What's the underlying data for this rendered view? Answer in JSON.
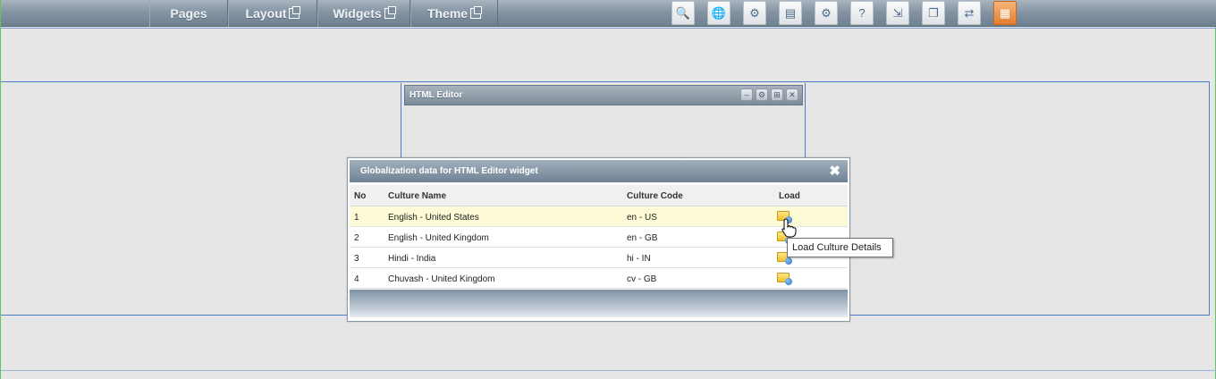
{
  "topbar": {
    "menu": [
      {
        "label": "Pages",
        "external": false
      },
      {
        "label": "Layout",
        "external": true
      },
      {
        "label": "Widgets",
        "external": true
      },
      {
        "label": "Theme",
        "external": true
      }
    ],
    "tools": [
      {
        "icon": "zoom-icon",
        "glyph": "🔍"
      },
      {
        "icon": "globe-icon",
        "glyph": "🌐"
      },
      {
        "icon": "globe-settings-icon",
        "glyph": "⚙"
      },
      {
        "icon": "page-icon",
        "glyph": "▤"
      },
      {
        "icon": "gear-icon",
        "glyph": "⚙"
      },
      {
        "icon": "help-icon",
        "glyph": "?"
      },
      {
        "icon": "export-icon",
        "glyph": "⇲"
      },
      {
        "icon": "windows-icon",
        "glyph": "❐"
      },
      {
        "icon": "flow-icon",
        "glyph": "⇄"
      },
      {
        "icon": "office-icon",
        "glyph": "▦"
      }
    ]
  },
  "widget": {
    "title": "HTML Editor",
    "controls": [
      "–",
      "⚙",
      "⊞",
      "✕"
    ]
  },
  "dialog": {
    "title": "Globalization data for HTML Editor widget",
    "close": "✖",
    "columns": {
      "no": "No",
      "name": "Culture Name",
      "code": "Culture Code",
      "load": "Load"
    },
    "rows": [
      {
        "no": "1",
        "name": "English - United States",
        "code": "en - US"
      },
      {
        "no": "2",
        "name": "English - United Kingdom",
        "code": "en - GB"
      },
      {
        "no": "3",
        "name": "Hindi - India",
        "code": "hi - IN"
      },
      {
        "no": "4",
        "name": "Chuvash - United Kingdom",
        "code": "cv - GB"
      }
    ]
  },
  "tooltip": "Load Culture Details"
}
